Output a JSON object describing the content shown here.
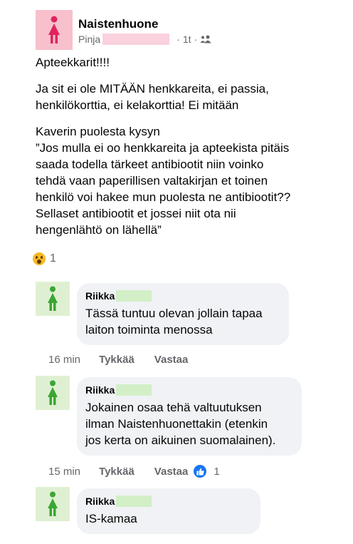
{
  "post": {
    "group_name": "Naistenhuone",
    "author": "Pinja",
    "time": "1t",
    "separator": "·",
    "body": [
      "Apteekkarit!!!!",
      "Ja sit ei ole MITÄÄN henkkareita, ei passia,\nhenkilökorttia, ei kelakorttia! Ei mitään",
      "Kaverin puolesta kysyn\n”Jos mulla ei oo henkkareita ja apteekista pitäis\nsaada todella tärkeet antibiootit niin voinko\ntehdä vaan paperillisen valtakirjan et toinen\nhenkilö voi hakee mun puolesta ne antibiootit??\nSellaset antibiootit et jossei niit ota nii\nhengenlähtö on lähellä”"
    ],
    "reaction_icon": "wow-emoji-icon",
    "reaction_count": "1"
  },
  "comments": [
    {
      "author": "Riikka",
      "text": "Tässä tuntuu olevan jollain tapaa\nlaiton toiminta menossa",
      "time": "16 min",
      "like_label": "Tykkää",
      "reply_label": "Vastaa"
    },
    {
      "author": "Riikka",
      "text": "Jokainen osaa tehä valtuutuksen\nilman Naistenhuonettakin (etenkin\njos kerta on aikuinen suomalainen).",
      "time": "15 min",
      "like_label": "Tykkää",
      "reply_label": "Vastaa",
      "like_count": "1"
    },
    {
      "author": "Riikka",
      "text": "IS-kamaa"
    }
  ],
  "colors": {
    "group_avatar_bg": "#f7c0cc",
    "group_avatar_figure": "#e0245e",
    "comment_avatar_bg": "#dff0d2",
    "comment_avatar_figure": "#3aa635",
    "like_blue": "#1877f2"
  }
}
